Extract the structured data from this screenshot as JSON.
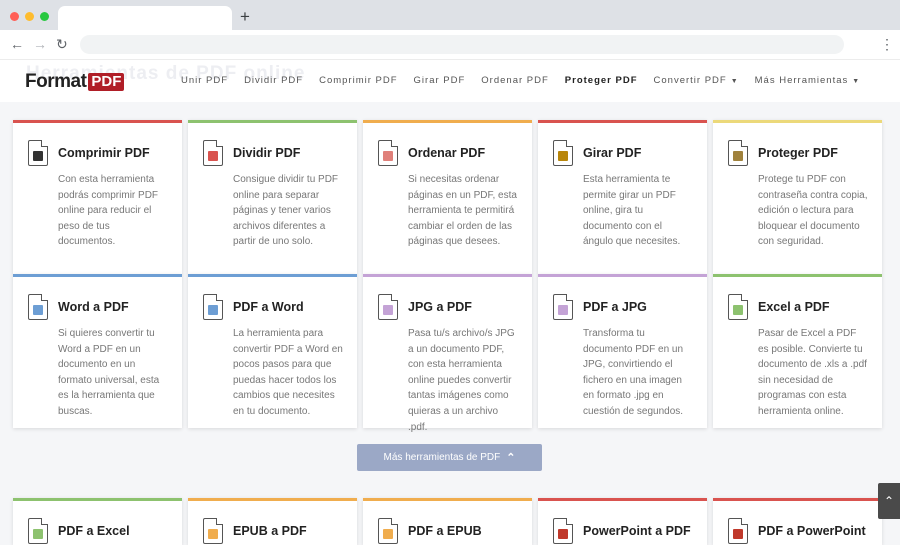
{
  "browser": {
    "new_tab": "+",
    "back": "←",
    "forward": "→",
    "reload": "↻",
    "menu": "⋮"
  },
  "header": {
    "logo_text": "Format",
    "logo_box": "PDF",
    "ghost_title": "Herramientas de PDF online",
    "nav": [
      {
        "label": "Unir PDF"
      },
      {
        "label": "Dividir PDF"
      },
      {
        "label": "Comprimir PDF"
      },
      {
        "label": "Girar PDF"
      },
      {
        "label": "Ordenar PDF"
      },
      {
        "label": "Proteger PDF",
        "active": true
      },
      {
        "label": "Convertir PDF",
        "dropdown": true
      },
      {
        "label": "Más Herramientas",
        "dropdown": true
      }
    ]
  },
  "colors": {
    "red": "#d9534f",
    "green": "#8dc26f",
    "orange": "#f0ad4e",
    "yellow": "#ecd97a",
    "blue": "#6d9ed4",
    "purple": "#c4a3d6",
    "brand": "#b01e27"
  },
  "rows": [
    [
      {
        "title": "Comprimir PDF",
        "desc": "Con esta herramienta podrás comprimir PDF online para reducir el peso de tus documentos.",
        "accent": "#d9534f",
        "icon": "compress-pdf-icon",
        "mark": "#333333"
      },
      {
        "title": "Dividir PDF",
        "desc": "Consigue dividir tu PDF online para separar páginas y tener varios archivos diferentes a partir de uno solo.",
        "accent": "#8dc26f",
        "icon": "split-pdf-icon",
        "mark": "#d9534f"
      },
      {
        "title": "Ordenar PDF",
        "desc": "Si necesitas ordenar páginas en un PDF, esta herramienta te permitirá cambiar el orden de las páginas que desees.",
        "accent": "#f0ad4e",
        "icon": "order-pdf-icon",
        "mark": "#e0807a"
      },
      {
        "title": "Girar PDF",
        "desc": "Esta herramienta te permite girar un PDF online, gira tu documento con el ángulo que necesites.",
        "accent": "#d9534f",
        "icon": "rotate-pdf-icon",
        "mark": "#b8860b"
      },
      {
        "title": "Proteger PDF",
        "desc": "Protege tu PDF con contraseña contra copia, edición o lectura para bloquear el documento con seguridad.",
        "accent": "#ecd97a",
        "icon": "protect-pdf-icon",
        "mark": "#a0823c"
      }
    ],
    [
      {
        "title": "Word a PDF",
        "desc": "Si quieres convertir tu Word a PDF en un documento en un formato universal, esta es la herramienta que buscas.",
        "accent": "#6d9ed4",
        "icon": "word-to-pdf-icon",
        "mark": "#6d9ed4"
      },
      {
        "title": "PDF a Word",
        "desc": "La herramienta para convertir PDF a Word en pocos pasos para que puedas hacer todos los cambios que necesites en tu documento.",
        "accent": "#6d9ed4",
        "icon": "pdf-to-word-icon",
        "mark": "#6d9ed4"
      },
      {
        "title": "JPG a PDF",
        "desc": "Pasa tu/s archivo/s JPG a un documento PDF, con esta herramienta online puedes convertir tantas imágenes como quieras a un archivo .pdf.",
        "accent": "#c4a3d6",
        "icon": "jpg-to-pdf-icon",
        "mark": "#c4a3d6"
      },
      {
        "title": "PDF a JPG",
        "desc": "Transforma tu documento PDF en un JPG, convirtiendo el fichero en una imagen en formato .jpg en cuestión de segundos.",
        "accent": "#c4a3d6",
        "icon": "pdf-to-jpg-icon",
        "mark": "#c4a3d6"
      },
      {
        "title": "Excel a PDF",
        "desc": "Pasar de Excel a PDF es posible. Convierte tu documento de .xls a .pdf sin necesidad de programas con esta herramienta online.",
        "accent": "#8dc26f",
        "icon": "excel-to-pdf-icon",
        "mark": "#8dc26f"
      }
    ],
    [
      {
        "title": "PDF a Excel",
        "desc": "",
        "accent": "#8dc26f",
        "icon": "pdf-to-excel-icon",
        "mark": "#8dc26f"
      },
      {
        "title": "EPUB a PDF",
        "desc": "",
        "accent": "#f0ad4e",
        "icon": "epub-to-pdf-icon",
        "mark": "#f0ad4e"
      },
      {
        "title": "PDF a EPUB",
        "desc": "",
        "accent": "#f0ad4e",
        "icon": "pdf-to-epub-icon",
        "mark": "#f0ad4e"
      },
      {
        "title": "PowerPoint a PDF",
        "desc": "",
        "accent": "#d9534f",
        "icon": "powerpoint-to-pdf-icon",
        "mark": "#c0392b"
      },
      {
        "title": "PDF a PowerPoint",
        "desc": "",
        "accent": "#d9534f",
        "icon": "pdf-to-powerpoint-icon",
        "mark": "#c0392b"
      }
    ]
  ],
  "more_button": {
    "label": "Más herramientas de PDF",
    "chevron": "⌃"
  },
  "scroll_top": {
    "glyph": "⌃"
  }
}
